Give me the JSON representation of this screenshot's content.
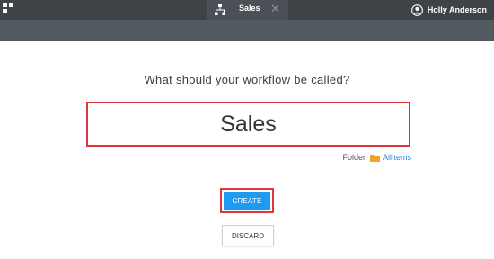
{
  "header": {
    "tab": {
      "label": "Sales",
      "icon": "workflow-icon",
      "close_icon": "close-icon"
    },
    "user": {
      "name": "Holly Anderson",
      "icon": "user-avatar-icon"
    },
    "menu_icon": "apps-grid-icon"
  },
  "main": {
    "question": "What should your workflow be called?",
    "workflow_name": "Sales",
    "folder": {
      "label": "Folder",
      "icon": "folder-icon",
      "link": "AllItems"
    },
    "create_label": "CREATE",
    "discard_label": "DISCARD"
  },
  "colors": {
    "topbar": "#3e4348",
    "subbar": "#52595f",
    "accent": "#1e9bf0",
    "highlight": "#e0353b",
    "folder": "#f0a32a",
    "link": "#2a7fd4"
  }
}
